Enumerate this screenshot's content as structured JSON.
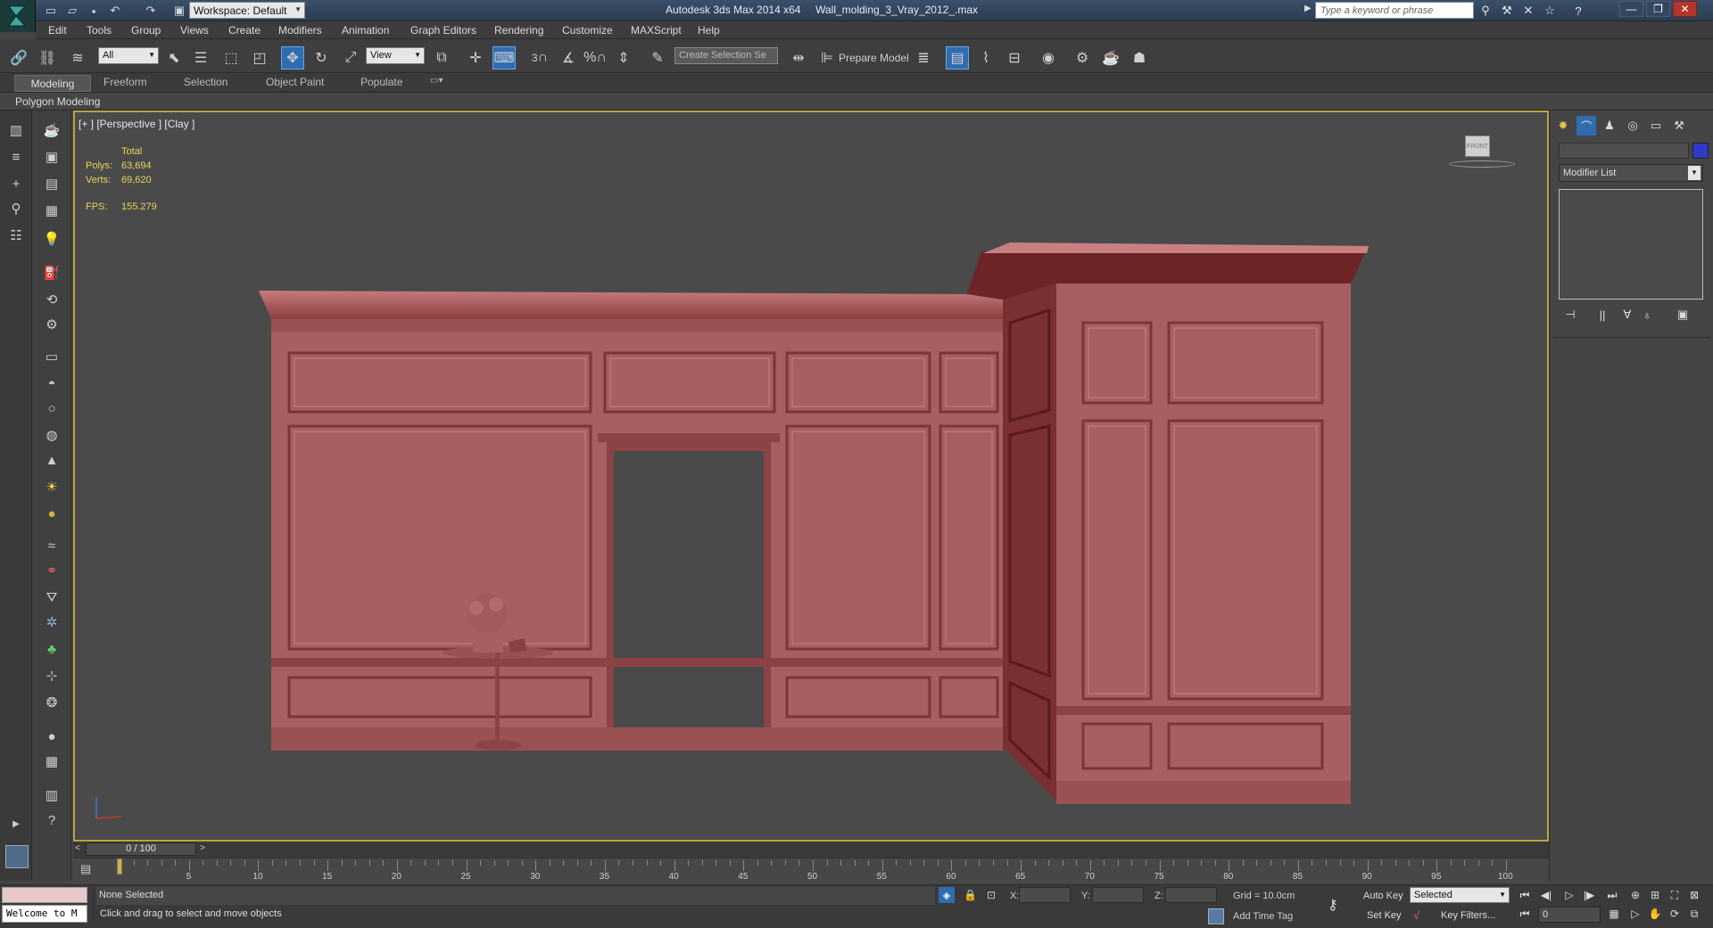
{
  "titlebar": {
    "workspace_label": "Workspace: Default",
    "app_title": "Autodesk 3ds Max  2014 x64",
    "file_title": "Wall_molding_3_Vray_2012_.max",
    "search_placeholder": "Type a keyword or phrase"
  },
  "menubar": {
    "items": [
      "Edit",
      "Tools",
      "Group",
      "Views",
      "Create",
      "Modifiers",
      "Animation",
      "Graph Editors",
      "Rendering",
      "Customize",
      "MAXScript",
      "Help"
    ]
  },
  "toolbar": {
    "filter_value": "All",
    "ref_coord_value": "View",
    "selection_set_placeholder": "Create Selection Se",
    "prepare_model_label": "Prepare Model",
    "snap_2d": "3",
    "snap_pct": "%"
  },
  "ribbon": {
    "tabs": [
      "Modeling",
      "Freeform",
      "Selection",
      "Object Paint",
      "Populate"
    ],
    "panel_label": "Polygon Modeling"
  },
  "viewport": {
    "label": "[+ ] [Perspective ] [Clay ]",
    "stats_total_label": "Total",
    "polys_label": "Polys:",
    "polys_value": "63,694",
    "verts_label": "Verts:",
    "verts_value": "69,620",
    "fps_label": "FPS:",
    "fps_value": "155.279",
    "viewcube_label": "FRONT",
    "model_color": "#a85f62"
  },
  "timeline": {
    "slider_label": "0 / 100",
    "current_frame": 0,
    "total_frames": 100,
    "tick_labels": [
      "5",
      "10",
      "15",
      "20",
      "25",
      "30",
      "35",
      "40",
      "45",
      "50",
      "55",
      "60",
      "65",
      "70",
      "75",
      "80",
      "85",
      "90",
      "95",
      "100"
    ]
  },
  "command_panel": {
    "modifier_list_label": "Modifier List",
    "object_color": "#2d3bc8"
  },
  "status": {
    "listener_text": "Welcome to M",
    "selection_text": "None Selected",
    "prompt_text": "Click and drag to select and move objects",
    "x_label": "X:",
    "y_label": "Y:",
    "z_label": "Z:",
    "grid_text": "Grid = 10.0cm",
    "add_time_tag": "Add Time Tag",
    "auto_key_label": "Auto Key",
    "set_key_label": "Set Key",
    "key_mode_value": "Selected",
    "key_filters_label": "Key Filters...",
    "frame_value": "0"
  }
}
